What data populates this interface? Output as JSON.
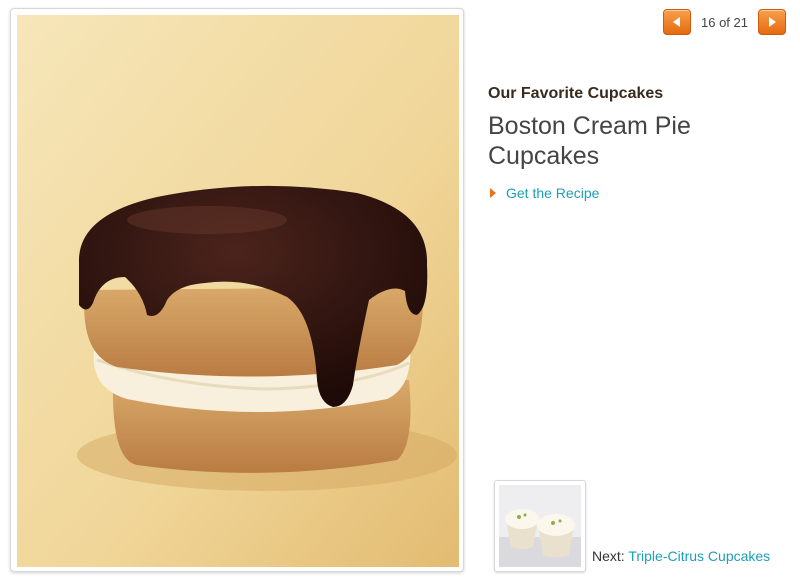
{
  "pager": {
    "counter": "16 of 21",
    "prev_icon": "triangle-left-icon",
    "next_icon": "triangle-right-icon"
  },
  "slide": {
    "category": "Our Favorite Cupcakes",
    "title": "Boston Cream Pie Cupcakes",
    "recipe_link": "Get the Recipe"
  },
  "next": {
    "label": "Next:",
    "link_text": "Triple-Citrus Cupcakes"
  },
  "colors": {
    "accent_orange": "#e8731a",
    "link_teal": "#1d9fb6",
    "category_brown": "#3a2a1e"
  }
}
